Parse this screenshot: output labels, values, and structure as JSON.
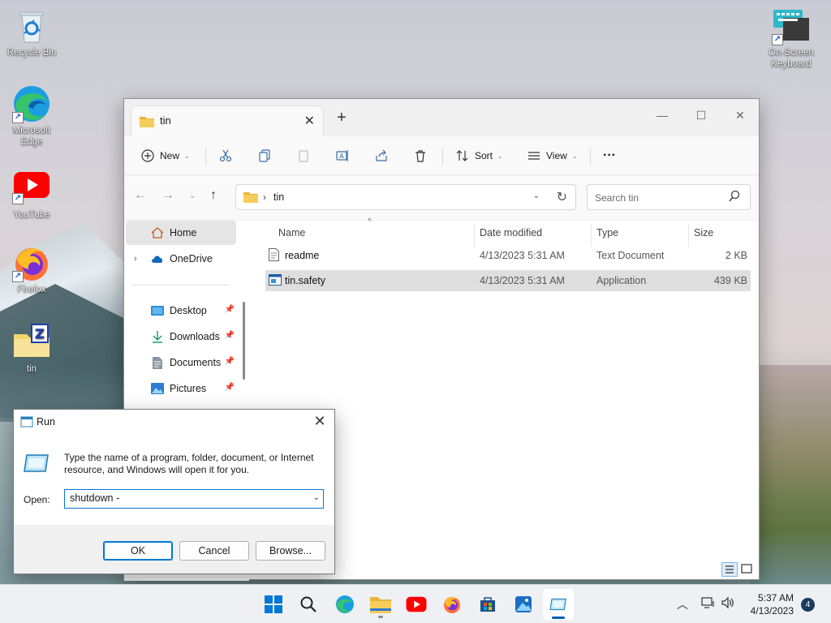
{
  "desktop": {
    "icons": [
      {
        "label": "Recycle Bin"
      },
      {
        "label": "Microsoft Edge"
      },
      {
        "label": "YouTube"
      },
      {
        "label": "Firefox"
      },
      {
        "label": "tin"
      },
      {
        "label": "On-Screen Keyboard"
      }
    ]
  },
  "explorer": {
    "tab_title": "tin",
    "toolbar": {
      "new_label": "New",
      "sort_label": "Sort",
      "view_label": "View",
      "more_label": "···"
    },
    "address": {
      "path": "tin",
      "search_placeholder": "Search tin"
    },
    "nav": {
      "items": [
        {
          "label": "Home"
        },
        {
          "label": "OneDrive"
        },
        {
          "label": "Desktop"
        },
        {
          "label": "Downloads"
        },
        {
          "label": "Documents"
        },
        {
          "label": "Pictures"
        }
      ]
    },
    "columns": [
      "Name",
      "Date modified",
      "Type",
      "Size"
    ],
    "files": [
      {
        "name": "readme",
        "date": "4/13/2023 5:31 AM",
        "type": "Text Document",
        "size": "2 KB"
      },
      {
        "name": "tin.safety",
        "date": "4/13/2023 5:31 AM",
        "type": "Application",
        "size": "439 KB"
      }
    ]
  },
  "run_dialog": {
    "title": "Run",
    "description": "Type the name of a program, folder, document, or Internet resource, and Windows will open it for you.",
    "open_label": "Open:",
    "input_value": "shutdown -",
    "ok_label": "OK",
    "cancel_label": "Cancel",
    "browse_label": "Browse..."
  },
  "taskbar": {
    "time": "5:37 AM",
    "date": "4/13/2023",
    "notification_count": "4"
  }
}
